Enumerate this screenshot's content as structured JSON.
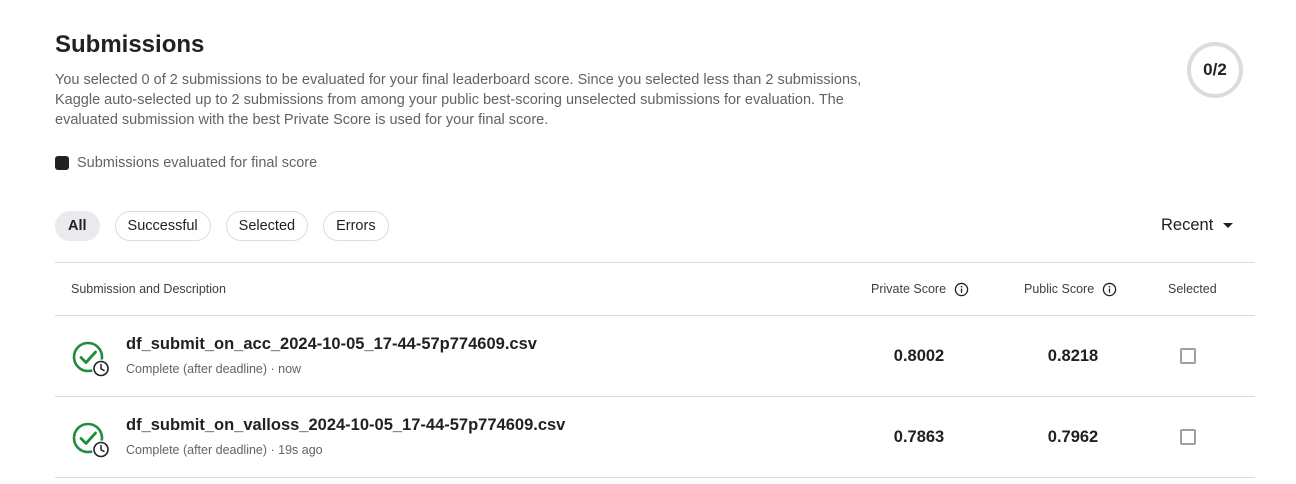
{
  "header": {
    "title": "Submissions",
    "description": "You selected 0 of 2 submissions to be evaluated for your final leaderboard score. Since you selected less than 2 submissions, Kaggle auto-selected up to 2 submissions from among your public best-scoring unselected submissions for evaluation. The evaluated submission with the best Private Score is used for your final score.",
    "counter": "0/2",
    "legend": "Submissions evaluated for final score"
  },
  "filters": [
    "All",
    "Successful",
    "Selected",
    "Errors"
  ],
  "active_filter": "All",
  "sort": {
    "label": "Recent"
  },
  "table": {
    "columns": {
      "description": "Submission and Description",
      "private": "Private Score",
      "public": "Public Score",
      "selected": "Selected"
    },
    "rows": [
      {
        "file": "df_submit_on_acc_2024-10-05_17-44-57p774609.csv",
        "meta": "Complete (after deadline) · now",
        "private_score": "0.8002",
        "public_score": "0.8218",
        "selected": false
      },
      {
        "file": "df_submit_on_valloss_2024-10-05_17-44-57p774609.csv",
        "meta": "Complete (after deadline) · 19s ago",
        "private_score": "0.7863",
        "public_score": "0.7962",
        "selected": false
      }
    ]
  },
  "colors": {
    "success_green": "#1e8e3e",
    "text_primary": "#202124",
    "text_secondary": "#5f6368",
    "border": "#dadce0"
  },
  "icons": {
    "status": "check-circle-clock-icon",
    "info": "info-icon",
    "sort": "caret-down-icon"
  }
}
